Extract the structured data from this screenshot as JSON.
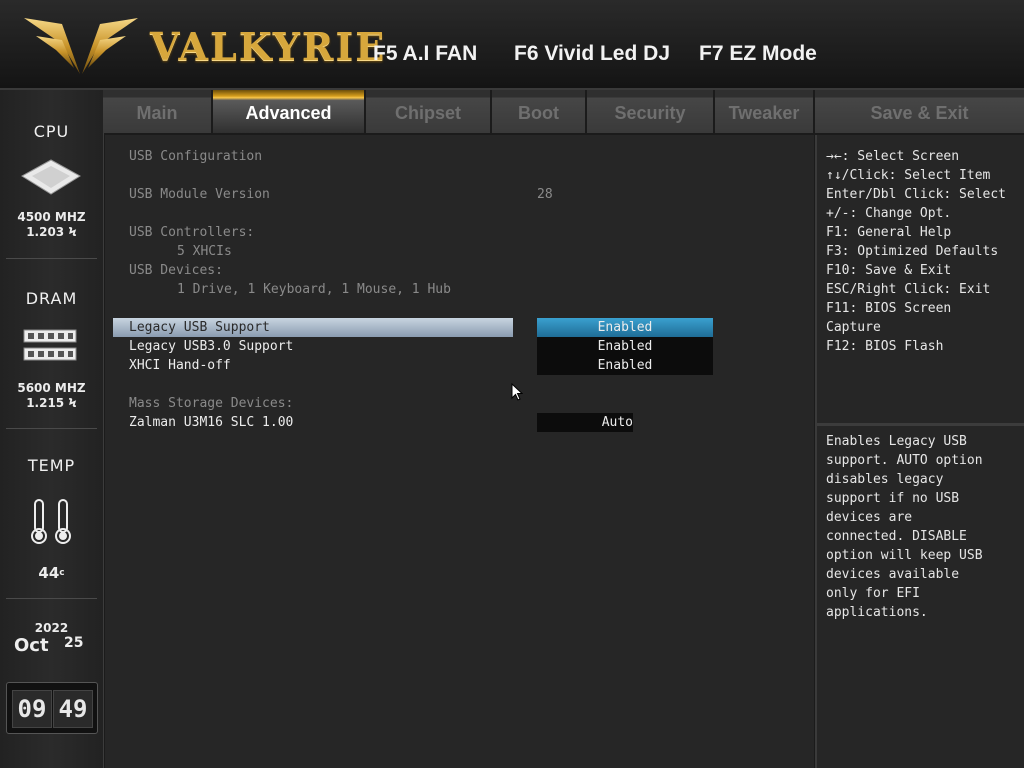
{
  "header": {
    "brand": "VALKYRIE",
    "hotkeys": [
      "F5 A.I FAN",
      "F6 Vivid Led DJ",
      "F7 EZ Mode"
    ]
  },
  "sidebar": {
    "cpu": {
      "title": "CPU",
      "freq": "4500 MHZ",
      "volt": "1.203"
    },
    "dram": {
      "title": "DRAM",
      "freq": "5600 MHZ",
      "volt": "1.215"
    },
    "temp": {
      "title": "TEMP",
      "value": "44",
      "unit": "c"
    },
    "date": {
      "year": "2022",
      "month": "Oct",
      "day": "25"
    },
    "clock": {
      "hour": "09",
      "minute": "49"
    }
  },
  "tabs": [
    {
      "label": "Main",
      "active": false
    },
    {
      "label": "Advanced",
      "active": true
    },
    {
      "label": "Chipset",
      "active": false
    },
    {
      "label": "Boot",
      "active": false
    },
    {
      "label": "Security",
      "active": false
    },
    {
      "label": "Tweaker",
      "active": false
    },
    {
      "label": "Save & Exit",
      "active": false
    }
  ],
  "main": {
    "section_title": "USB Configuration",
    "module_version_label": "USB Module Version",
    "module_version_value": "28",
    "controllers_label": "USB Controllers:",
    "controllers_value": "5 XHCIs",
    "devices_label": "USB Devices:",
    "devices_value": "1 Drive, 1 Keyboard, 1 Mouse, 1 Hub",
    "options": [
      {
        "label": "Legacy USB Support",
        "value": "Enabled",
        "selected": true
      },
      {
        "label": "Legacy USB3.0 Support",
        "value": "Enabled",
        "selected": false
      },
      {
        "label": "XHCI Hand-off",
        "value": "Enabled",
        "selected": false
      }
    ],
    "mass_storage_label": "Mass Storage Devices:",
    "mass_storage_device": "Zalman U3M16 SLC 1.00",
    "mass_storage_value": "Auto"
  },
  "help": {
    "keys": [
      "→←: Select Screen",
      "↑↓/Click: Select Item",
      "Enter/Dbl Click: Select",
      "+/-: Change Opt.",
      "F1: General Help",
      "F3: Optimized Defaults",
      "F10: Save & Exit",
      "ESC/Right Click: Exit",
      "F11: BIOS Screen",
      "Capture",
      "F12: BIOS Flash"
    ],
    "description": [
      "Enables Legacy USB",
      "support. AUTO option",
      "disables legacy",
      "support if no USB",
      "devices are",
      "connected. DISABLE",
      "option will keep USB",
      "devices available",
      "only for EFI",
      "applications."
    ]
  },
  "colors": {
    "accent_gold": "#d7a73c",
    "selected_value": "#2a86b5"
  }
}
